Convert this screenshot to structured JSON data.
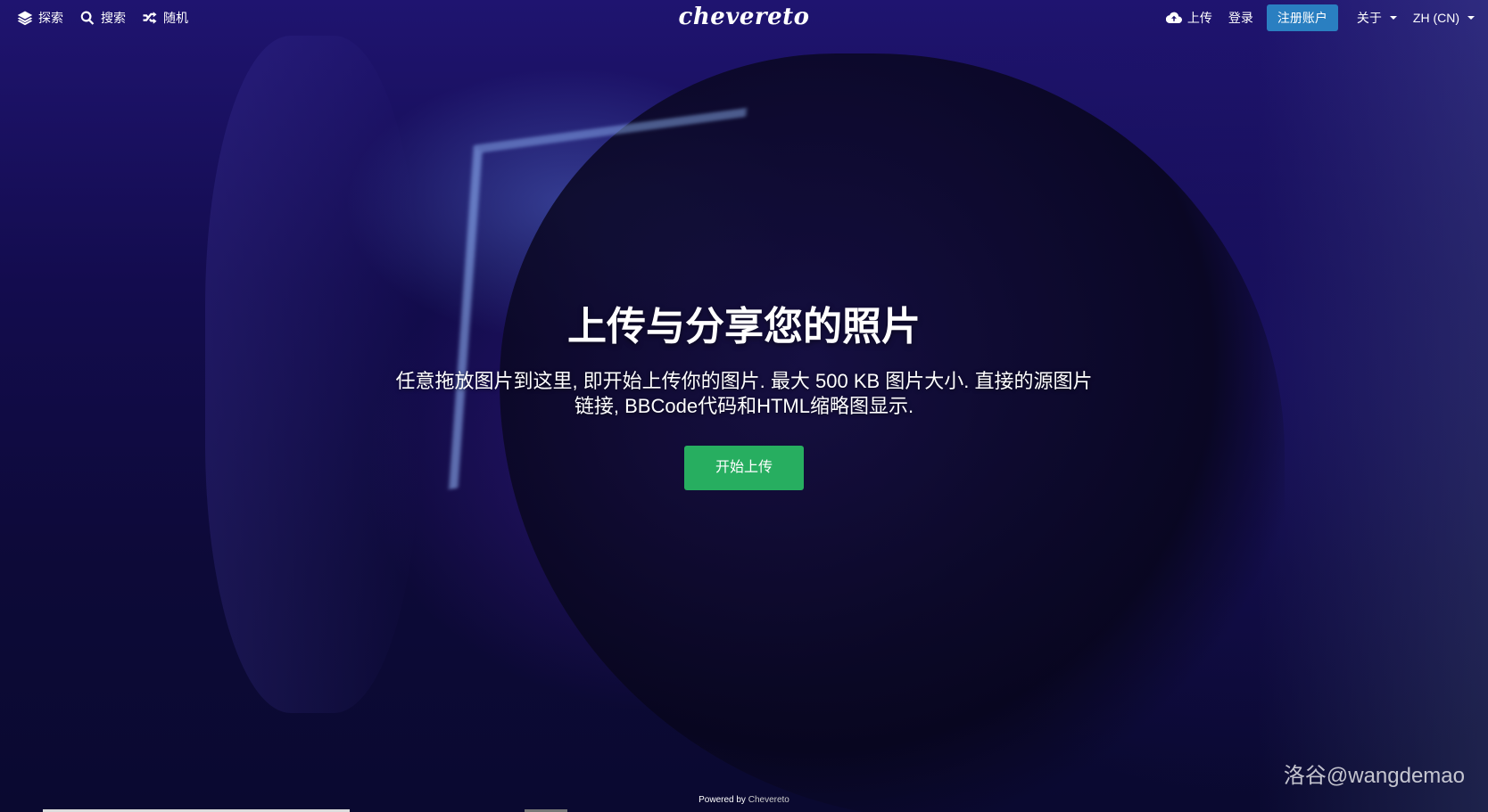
{
  "nav_left": [
    {
      "label": "探索",
      "icon": "layers-icon"
    },
    {
      "label": "搜索",
      "icon": "search-icon"
    },
    {
      "label": "随机",
      "icon": "shuffle-icon"
    }
  ],
  "logo": "chevereto",
  "nav_right": {
    "upload": "上传",
    "upload_icon": "cloud-upload-icon",
    "login": "登录",
    "signup": "注册账户",
    "about": "关于",
    "language": "ZH (CN)"
  },
  "hero": {
    "title": "上传与分享您的照片",
    "text": "任意拖放图片到这里, 即开始上传你的图片. 最大 500 KB 图片大小. 直接的源图片链接, BBCode代码和HTML缩略图显示.",
    "button": "开始上传"
  },
  "footer": {
    "powered_prefix": "Powered by",
    "powered_brand": "Chevereto"
  },
  "watermark": "洛谷@wangdemao",
  "colors": {
    "signup_button": "#2a7fc1",
    "start_button": "#27ae60"
  }
}
